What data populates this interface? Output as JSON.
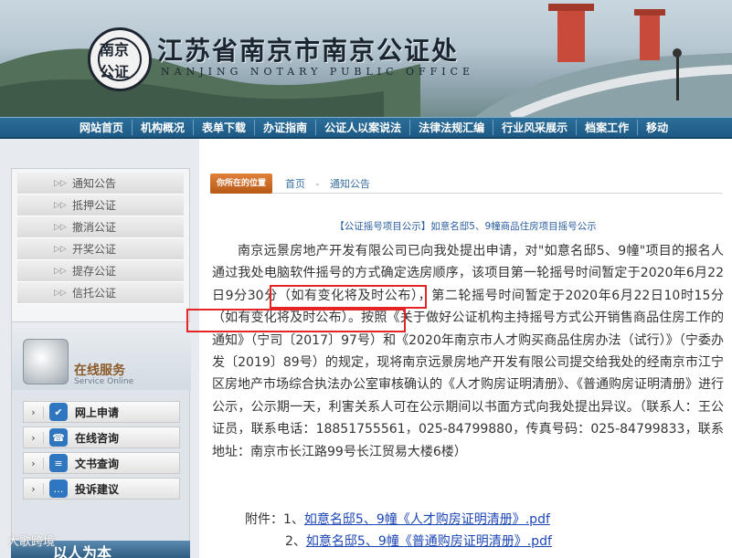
{
  "header": {
    "title": "江苏省南京市南京公证处",
    "subtitle": "NANJING NOTARY PUBLIC OFFICE",
    "logo_text": "南京公证"
  },
  "nav": {
    "items": [
      "网站首页",
      "机构概况",
      "表单下载",
      "办证指南",
      "公证人以案说法",
      "法律法规汇编",
      "行业风采展示",
      "档案工作",
      "移动"
    ]
  },
  "sidebar": {
    "menu": [
      "通知公告",
      "抵押公证",
      "撤消公证",
      "开奖公证",
      "提存公证",
      "信托公证"
    ],
    "service": {
      "title": "在线服务",
      "subtitle": "Service Online",
      "items": [
        {
          "label": "网上申请",
          "icon": "checklist-icon"
        },
        {
          "label": "在线咨询",
          "icon": "headset-icon"
        },
        {
          "label": "文书查询",
          "icon": "document-icon"
        },
        {
          "label": "投诉建议",
          "icon": "chat-icon"
        }
      ]
    },
    "watermark": "大歌跨境",
    "bottom_banner": "以人为本"
  },
  "breadcrumb": {
    "label": "你所在的位置",
    "home": "首页",
    "separator": "-",
    "current": "通知公告"
  },
  "article": {
    "title": "【公证摇号项目公示】如意名邸5、9幢商品住房项目摇号公示",
    "body": "南京远景房地产开发有限公司已向我处提出申请，对\"如意名邸5、9幢\"项目的报名人通过我处电脑软件摇号的方式确定选房顺序，该项目第一轮摇号时间暂定于2020年6月22日9分30分（如有变化将及时公布），第二轮摇号时间暂定于2020年6月22日10时15分（如有变化将及时公布）。按照《关于做好公证机构主持摇号方式公开销售商品住房工作的通知》（宁司〔2017〕97号）和《2020年南京市人才购买商品住房办法（试行）》（宁委办发〔2019〕89号）的规定，现将南京远景房地产开发有限公司提交给我处的经南京市江宁区房地产市场综合执法办公室审核确认的《人才购房证明清册》、《普通购房证明清册》进行公示，公示期一天，利害关系人可在公示期间以书面方式向我处提出异议。（联系人：王公证员，联系电话：18851755561，025-84799880，传真号码：025-84799833，联系地址：南京市长江路99号长江贸易大楼6楼）",
    "highlight_1": "2020年6月22日9分30分",
    "highlight_2": "2020年6月22日10时15分",
    "attachments_label": "附件：",
    "attachments": [
      {
        "num": "1、",
        "text": "如意名邸5、9幢《人才购房证明清册》.pdf"
      },
      {
        "num": "2、",
        "text": "如意名邸5、9幢《普通购房证明清册》.pdf"
      }
    ]
  },
  "colors": {
    "nav": "#1d5a85",
    "link": "#1b46b4",
    "highlight_box": "#e52525",
    "badge": "#c9651f"
  }
}
